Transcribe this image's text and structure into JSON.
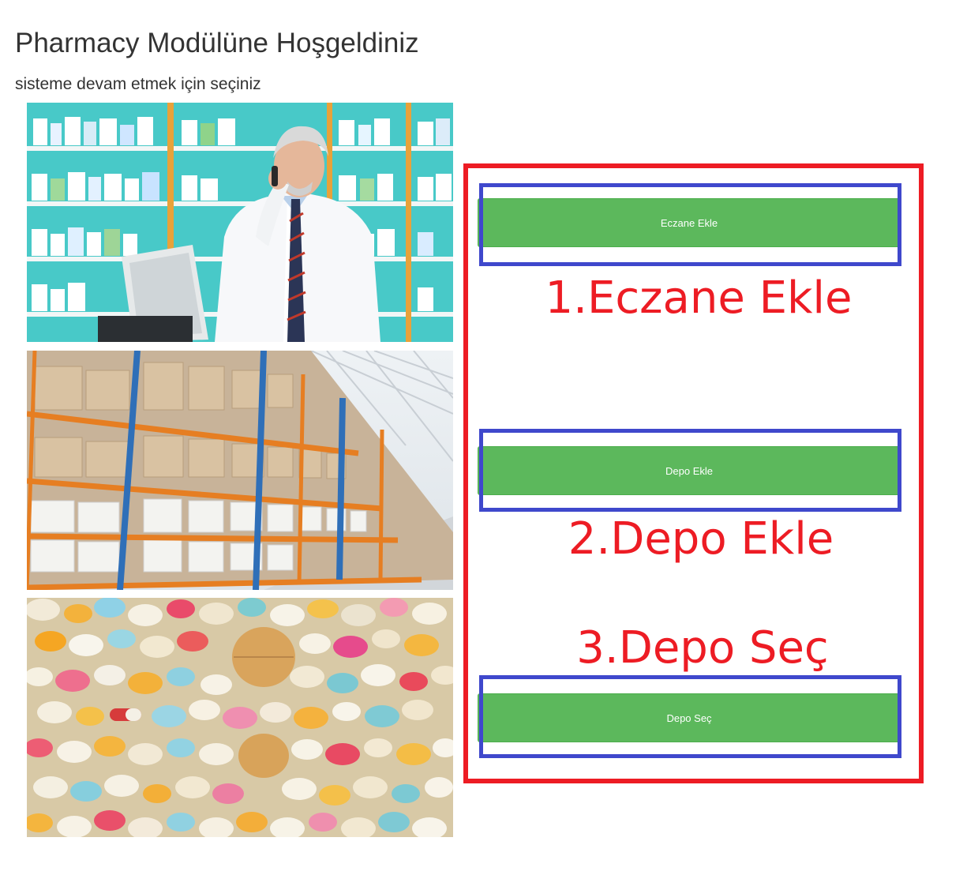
{
  "header": {
    "title": "Pharmacy Modülüne Hoşgeldiniz",
    "subtitle": "sisteme devam etmek için seçiniz"
  },
  "images": [
    {
      "name": "pharmacist-photo",
      "description_icon": "pharmacist-on-phone-image"
    },
    {
      "name": "warehouse-photo",
      "description_icon": "warehouse-shelves-image"
    },
    {
      "name": "pills-photo",
      "description_icon": "pills-pile-image"
    }
  ],
  "actions": {
    "add_pharmacy_label": "Eczane Ekle",
    "add_depot_label": "Depo Ekle",
    "select_depot_label": "Depo Seç"
  },
  "annotations": {
    "step1": "1.Eczane Ekle",
    "step2": "2.Depo Ekle",
    "step3": "3.Depo Seç"
  },
  "colors": {
    "button_green": "#5cb85c",
    "annotation_red": "#ed1c24",
    "annotation_blue": "#3f48cc"
  }
}
